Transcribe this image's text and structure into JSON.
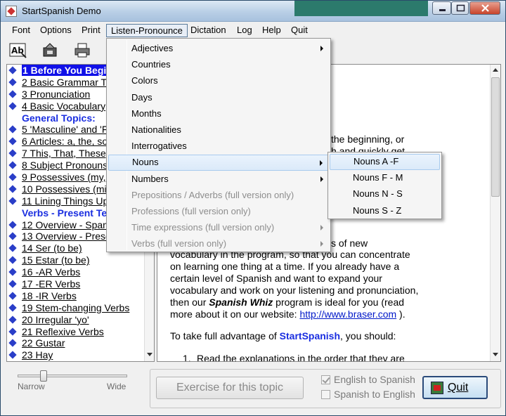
{
  "window": {
    "title": "StartSpanish Demo"
  },
  "menubar": [
    "Font",
    "Options",
    "Print",
    "Listen-Pronounce",
    "Dictation",
    "Log",
    "Help",
    "Quit"
  ],
  "sidebar": {
    "items": [
      {
        "label": "1 Before You Begin",
        "type": "selected"
      },
      {
        "label": "2 Basic Grammar Terms",
        "type": "link"
      },
      {
        "label": "3 Pronunciation",
        "type": "link"
      },
      {
        "label": "4 Basic Vocabulary",
        "type": "link"
      },
      {
        "label": "General Topics:",
        "type": "heading"
      },
      {
        "label": "5 'Masculine' and 'Feminine'",
        "type": "link"
      },
      {
        "label": "6 Articles: a, the, some",
        "type": "link"
      },
      {
        "label": "7 This, That, These, Those",
        "type": "link"
      },
      {
        "label": "8 Subject Pronouns",
        "type": "link"
      },
      {
        "label": "9 Possessives (my, your)",
        "type": "link"
      },
      {
        "label": "10 Possessives (mine, yours)",
        "type": "link"
      },
      {
        "label": "11 Lining Things Up",
        "type": "link"
      },
      {
        "label": "Verbs - Present Tense:",
        "type": "heading"
      },
      {
        "label": "12 Overview - Spanish Verbs",
        "type": "link"
      },
      {
        "label": "13 Overview - Present Tense",
        "type": "link"
      },
      {
        "label": "14 Ser (to be)",
        "type": "link"
      },
      {
        "label": "15 Estar (to be)",
        "type": "link"
      },
      {
        "label": "16 -AR Verbs",
        "type": "link"
      },
      {
        "label": "17 -ER Verbs",
        "type": "link"
      },
      {
        "label": "18 -IR Verbs",
        "type": "link"
      },
      {
        "label": "19 Stem-changing Verbs",
        "type": "link"
      },
      {
        "label": "20 Irregular 'yo'",
        "type": "link"
      },
      {
        "label": "21 Reflexive Verbs",
        "type": "link"
      },
      {
        "label": "22 Gustar",
        "type": "link"
      },
      {
        "label": "23 Hay",
        "type": "link"
      }
    ]
  },
  "content": {
    "frag1": "the beginning, or",
    "frag2": "h and quickly get",
    "frag3": "s of new",
    "para_lines": [
      "vocabulary in the program, so that you can concentrate",
      "on learning one thing at a time. If you already have a",
      "certain level of Spanish and want to expand your",
      "vocabulary and work on your listening and pronunciation,"
    ],
    "line5_pre": "then our ",
    "line5_emph": "Spanish Whiz",
    "line5_post": " program is ideal for you (read",
    "line6_pre": "more about it on our website: ",
    "line6_link": "http://www.braser.com",
    "line6_post": " ).",
    "advantage_pre": "To take full advantage of ",
    "advantage_brand": "StartSpanish",
    "advantage_post": ", you should:",
    "step1_num": "1.",
    "step1_text": "Read the explanations in the order that they are"
  },
  "listen_menu": {
    "items": [
      {
        "label": "Adjectives",
        "submenu": true,
        "disabled": false
      },
      {
        "label": "Countries",
        "submenu": false,
        "disabled": false
      },
      {
        "label": "Colors",
        "submenu": false,
        "disabled": false
      },
      {
        "label": "Days",
        "submenu": false,
        "disabled": false
      },
      {
        "label": "Months",
        "submenu": false,
        "disabled": false
      },
      {
        "label": "Nationalities",
        "submenu": false,
        "disabled": false
      },
      {
        "label": "Interrogatives",
        "submenu": false,
        "disabled": false
      },
      {
        "label": "Nouns",
        "submenu": true,
        "disabled": false
      },
      {
        "label": "Numbers",
        "submenu": true,
        "disabled": false
      },
      {
        "label": "Prepositions / Adverbs (full version only)",
        "submenu": false,
        "disabled": true
      },
      {
        "label": "Professions (full version only)",
        "submenu": false,
        "disabled": true
      },
      {
        "label": "Time expressions (full version only)",
        "submenu": true,
        "disabled": true
      },
      {
        "label": "Verbs (full version only)",
        "submenu": true,
        "disabled": true
      }
    ]
  },
  "nouns_menu": {
    "items": [
      "Nouns A -F",
      "Nouns F - M",
      "Nouns N - S",
      "Nouns S - Z"
    ]
  },
  "slider": {
    "left_label": "Narrow",
    "right_label": "Wide"
  },
  "bottom": {
    "exercise_label": "Exercise for this topic",
    "english_to_spanish": "English to Spanish",
    "spanish_to_english": "Spanish to English",
    "quit_label": "Quit"
  }
}
